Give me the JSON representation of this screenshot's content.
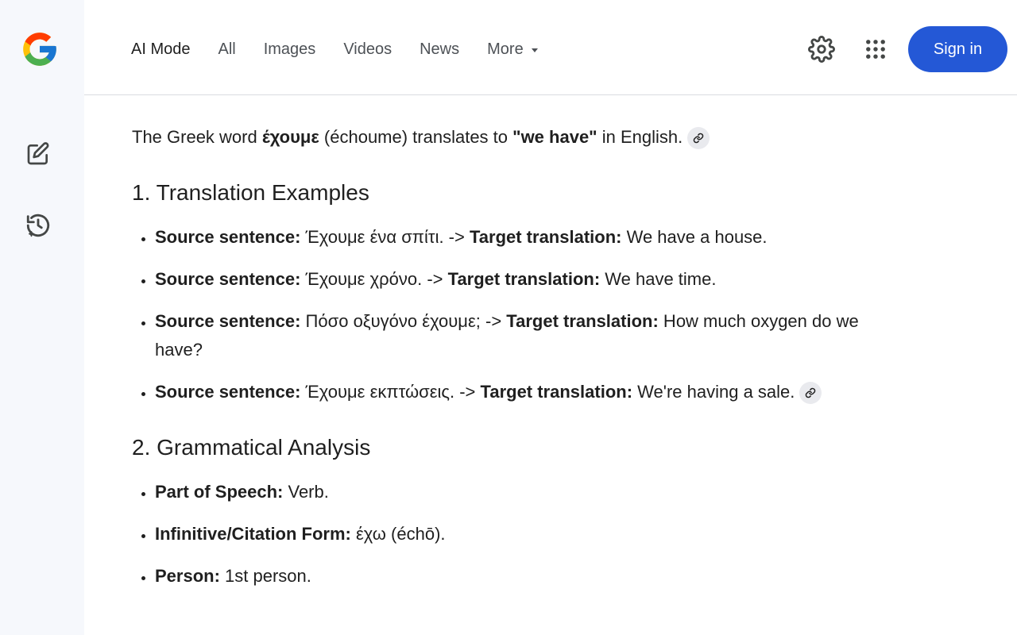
{
  "nav": {
    "items": [
      "AI Mode",
      "All",
      "Images",
      "Videos",
      "News",
      "More"
    ]
  },
  "header": {
    "signin_label": "Sign in"
  },
  "icons": {
    "logo": "google-logo",
    "new_chat": "edit-icon",
    "history": "history-icon",
    "settings": "gear-icon",
    "apps": "apps-grid-icon",
    "link": "link-icon"
  },
  "colors": {
    "signin_bg": "#2458d6",
    "sidebar_bg": "#f6f8fc"
  },
  "answer": {
    "intro": {
      "p1": "The Greek word ",
      "word": "έχουμε",
      "p2": " (échoume) translates to ",
      "meaning": "\"we have\"",
      "p3": " in English."
    },
    "section1": {
      "title": "1. Translation Examples",
      "items": [
        {
          "l1": "Source sentence:",
          "v1": " Έχουμε ένα σπίτι. -> ",
          "l2": "Target translation:",
          "v2": " We have a house."
        },
        {
          "l1": "Source sentence:",
          "v1": " Έχουμε χρόνο. -> ",
          "l2": "Target translation:",
          "v2": " We have time."
        },
        {
          "l1": "Source sentence:",
          "v1": " Πόσο οξυγόνο έχουμε; -> ",
          "l2": "Target translation:",
          "v2": " How much oxygen do we have?"
        },
        {
          "l1": "Source sentence:",
          "v1": " Έχουμε εκπτώσεις. -> ",
          "l2": "Target translation:",
          "v2": " We're having a sale."
        }
      ]
    },
    "section2": {
      "title": "2. Grammatical Analysis",
      "items": [
        {
          "label": "Part of Speech:",
          "value": " Verb."
        },
        {
          "label": "Infinitive/Citation Form:",
          "value": " έχω (échō)."
        },
        {
          "label": "Person:",
          "value": " 1st person."
        }
      ]
    }
  }
}
